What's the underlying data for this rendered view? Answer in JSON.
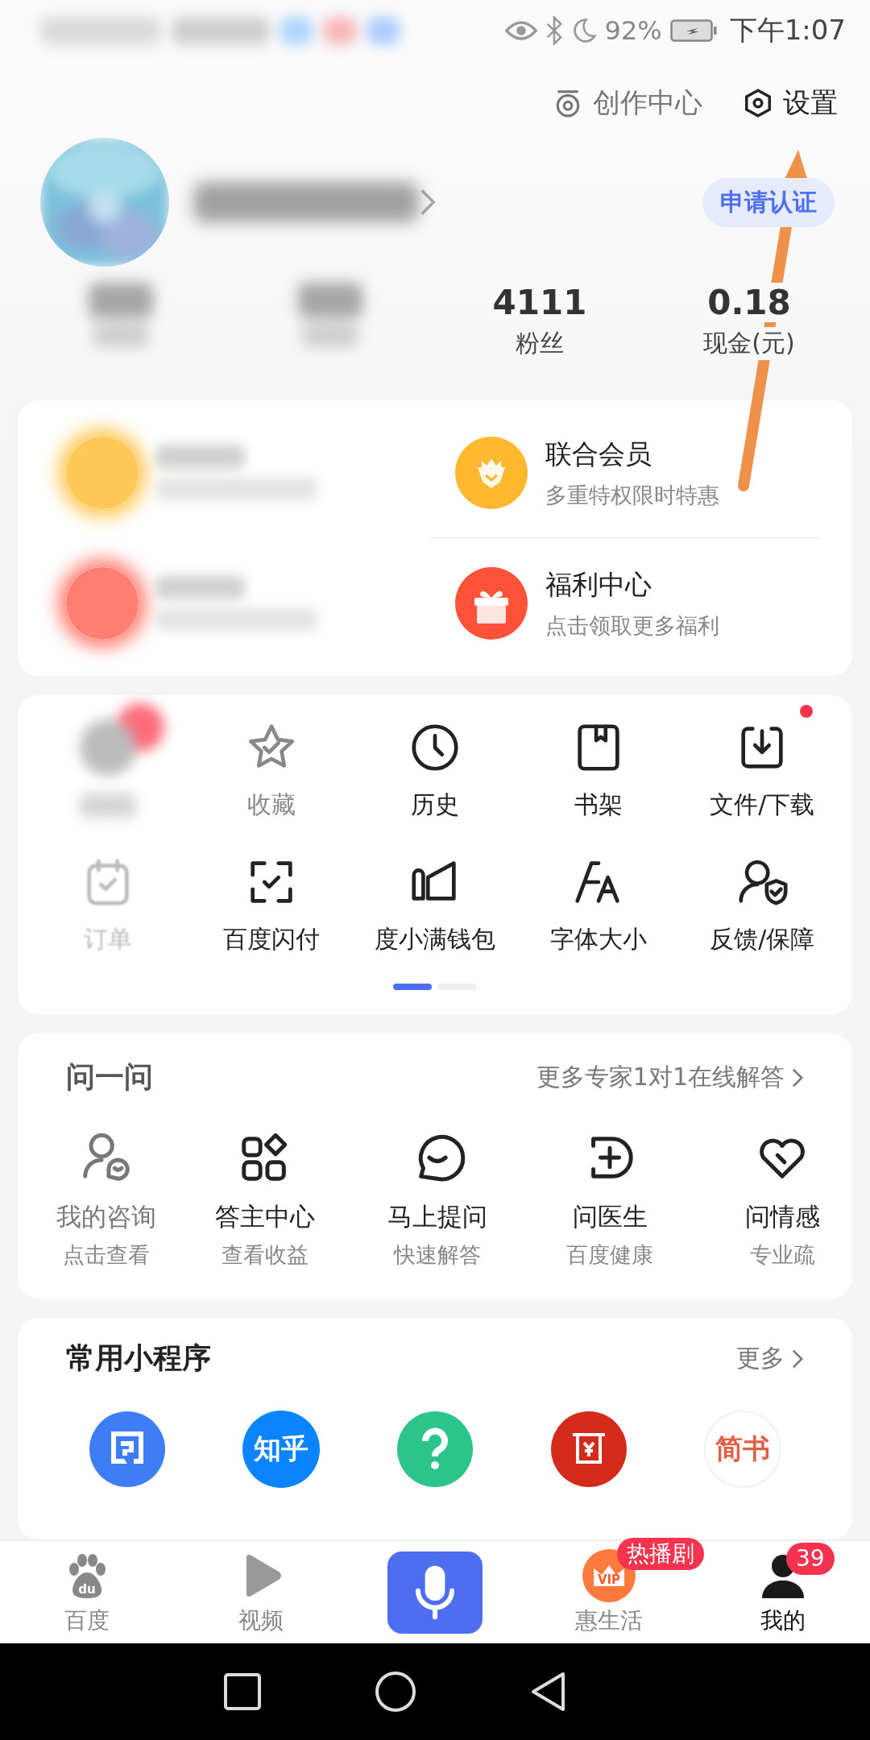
{
  "status_bar": {
    "battery": "92%",
    "time": "下午1:07"
  },
  "header_actions": [
    {
      "label": "创作中心",
      "faded": true
    },
    {
      "label": "设置",
      "faded": false
    }
  ],
  "profile": {
    "verify_button": "申请认证"
  },
  "stats": [
    {
      "kind": "blurred"
    },
    {
      "kind": "blurred"
    },
    {
      "kind": "normal",
      "value": "4111",
      "label": "粉丝"
    },
    {
      "kind": "normal",
      "value": "0.18",
      "label": "现金(元)"
    }
  ],
  "promo_items": [
    {
      "kind": "blurred",
      "color": "#ffc857"
    },
    {
      "kind": "normal",
      "title": "联合会员",
      "subtitle": "多重特权限时特惠",
      "color": "#ffb830"
    },
    {
      "kind": "blurred",
      "color": "#ff7f72"
    },
    {
      "kind": "normal",
      "title": "福利中心",
      "subtitle": "点击领取更多福利",
      "color": "#ff5238"
    }
  ],
  "tools": [
    {
      "kind": "blurred",
      "dot": false
    },
    {
      "kind": "faded",
      "label": "收藏",
      "dot": false
    },
    {
      "kind": "normal",
      "label": "历史",
      "dot": false
    },
    {
      "kind": "normal",
      "label": "书架",
      "dot": false
    },
    {
      "kind": "normal",
      "label": "文件/下载",
      "dot": true
    },
    {
      "kind": "faded",
      "label": "订单",
      "dot": false
    },
    {
      "kind": "normal",
      "label": "百度闪付",
      "dot": false
    },
    {
      "kind": "normal",
      "label": "度小满钱包",
      "dot": false
    },
    {
      "kind": "normal",
      "label": "字体大小",
      "dot": false
    },
    {
      "kind": "normal",
      "label": "反馈/保障",
      "dot": false
    }
  ],
  "pager": [
    {
      "selected": true
    },
    {
      "selected": false
    }
  ],
  "ask": {
    "title": "问一问",
    "more": "更多专家1对1在线解答",
    "items": [
      {
        "title": "我的咨询",
        "subtitle": "点击查看",
        "faded": true
      },
      {
        "title": "答主中心",
        "subtitle": "查看收益",
        "faded": false
      },
      {
        "title": "马上提问",
        "subtitle": "快速解答",
        "faded": false
      },
      {
        "title": "问医生",
        "subtitle": "百度健康",
        "faded": false
      },
      {
        "title": "问情感",
        "subtitle": "专业疏",
        "faded": false
      }
    ]
  },
  "mini_programs": {
    "title": "常用小程序",
    "more": "更多",
    "items": [
      {
        "kind": "glyph",
        "color": "#3d7df5"
      },
      {
        "kind": "text",
        "logo_text": "知乎",
        "color": "#0a84ff"
      },
      {
        "kind": "question",
        "color": "#2bc48a"
      },
      {
        "kind": "receipt",
        "color": "#d42a1c"
      },
      {
        "kind": "text-light",
        "logo_text": "简书",
        "color": "#e0604a"
      }
    ]
  },
  "bottom_nav": [
    {
      "kind": "paw",
      "label": "百度",
      "icon_text": "du",
      "selected": false
    },
    {
      "kind": "play",
      "label": "视频",
      "selected": false
    },
    {
      "kind": "mic"
    },
    {
      "kind": "vip",
      "label": "惠生活",
      "icon_text": "VIP",
      "badge": "热播剧",
      "selected": false
    },
    {
      "kind": "user",
      "label": "我的",
      "badge": "39",
      "selected": true
    }
  ]
}
